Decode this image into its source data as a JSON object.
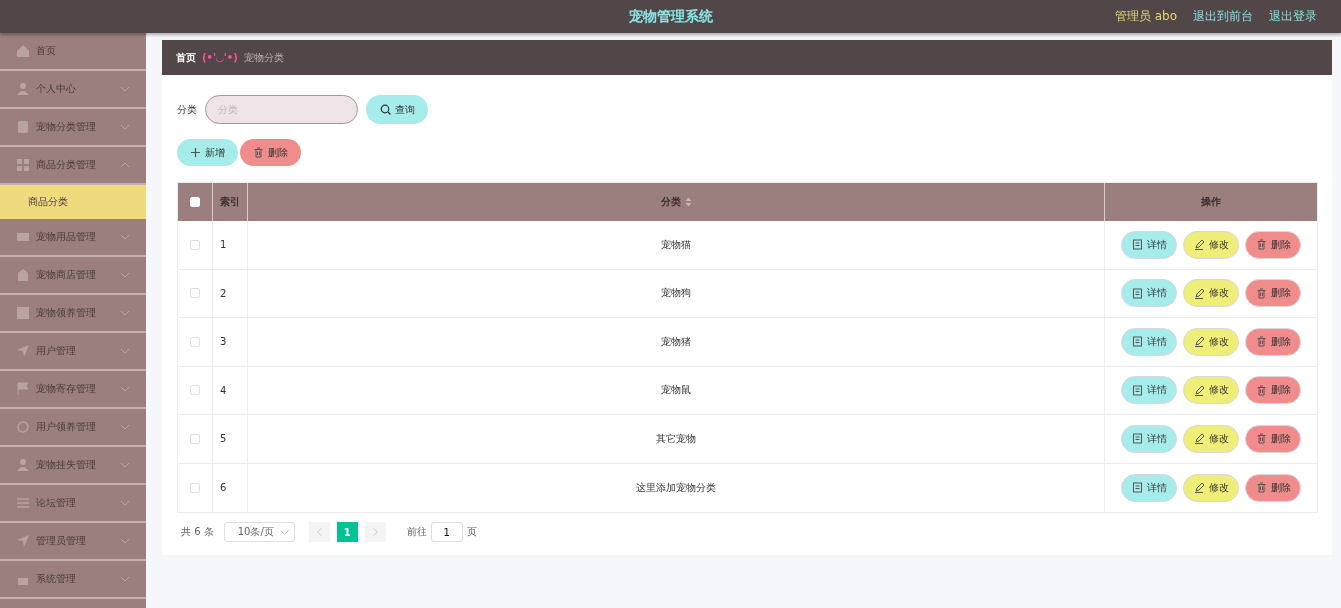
{
  "header": {
    "title": "宠物管理系统",
    "user": "管理员 abo",
    "links": [
      "退出到前台",
      "退出登录"
    ]
  },
  "sidebar": {
    "items": [
      {
        "label": "首页",
        "selected": false
      },
      {
        "label": "个人中心",
        "selected": false,
        "expanded": false
      },
      {
        "label": "宠物分类管理",
        "selected": false,
        "expanded": false
      },
      {
        "label": "商品分类管理",
        "selected": false,
        "expanded": true,
        "children": [
          {
            "label": "商品分类",
            "selected": true
          }
        ]
      },
      {
        "label": "宠物用品管理",
        "selected": false,
        "expanded": false
      },
      {
        "label": "宠物商店管理",
        "selected": false,
        "expanded": false
      },
      {
        "label": "宠物领养管理",
        "selected": false,
        "expanded": false
      },
      {
        "label": "用户管理",
        "selected": false,
        "expanded": false
      },
      {
        "label": "宠物寄存管理",
        "selected": false,
        "expanded": false
      },
      {
        "label": "用户领养管理",
        "selected": false,
        "expanded": false
      },
      {
        "label": "宠物挂失管理",
        "selected": false,
        "expanded": false
      },
      {
        "label": "论坛管理",
        "selected": false,
        "expanded": false
      },
      {
        "label": "管理员管理",
        "selected": false,
        "expanded": false
      },
      {
        "label": "系统管理",
        "selected": false,
        "expanded": false
      }
    ]
  },
  "breadcrumb": {
    "home": "首页",
    "separator": "(•'◡'•)",
    "current": "宠物分类"
  },
  "search": {
    "label": "分类",
    "placeholder": "分类",
    "button": "查询"
  },
  "actions": [
    {
      "label": "新增",
      "kind": "add"
    },
    {
      "label": "删除",
      "kind": "delete"
    }
  ],
  "table": {
    "select_all": {
      "checked": false
    },
    "columns": [
      "索引",
      "分类",
      "操作"
    ],
    "rows": [
      {
        "checked": false,
        "index": "1",
        "category": "宠物猫",
        "buttons": [
          "详情",
          "修改",
          "删除"
        ]
      },
      {
        "checked": false,
        "index": "2",
        "category": "宠物狗",
        "buttons": [
          "详情",
          "修改",
          "删除"
        ]
      },
      {
        "checked": false,
        "index": "3",
        "category": "宠物猪",
        "buttons": [
          "详情",
          "修改",
          "删除"
        ]
      },
      {
        "checked": false,
        "index": "4",
        "category": "宠物鼠",
        "buttons": [
          "详情",
          "修改",
          "删除"
        ]
      },
      {
        "checked": false,
        "index": "5",
        "category": "其它宠物",
        "buttons": [
          "详情",
          "修改",
          "删除"
        ]
      },
      {
        "checked": false,
        "index": "6",
        "category": "这里添加宠物分类",
        "buttons": [
          "详情",
          "修改",
          "删除"
        ]
      }
    ]
  },
  "pagination": {
    "total": "共 6 条",
    "page_size": "10条/页",
    "pages": [
      {
        "label": "1",
        "selected": true
      }
    ],
    "goto_label": "前往",
    "goto_value": "1",
    "goto_suffix": "页"
  }
}
